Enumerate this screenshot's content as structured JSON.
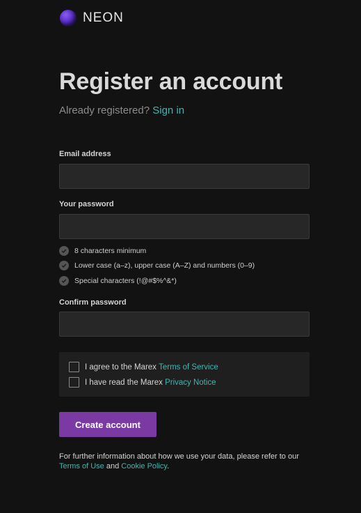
{
  "brand": {
    "name": "NEON"
  },
  "form": {
    "title": "Register an account",
    "already_registered": "Already registered?",
    "sign_in_link": "Sign in",
    "email_label": "Email address",
    "email_value": "",
    "password_label": "Your password",
    "password_value": "",
    "password_rules": [
      "8 characters minimum",
      "Lower case (a–z), upper case (A–Z) and numbers (0–9)",
      "Special characters (!@#$%^&*)"
    ],
    "confirm_label": "Confirm password",
    "confirm_value": ""
  },
  "agreements": {
    "terms_prefix": "I agree to the Marex",
    "terms_link": "Terms of Service",
    "terms_checked": false,
    "privacy_prefix": "I have read the Marex",
    "privacy_link": "Privacy Notice",
    "privacy_checked": false
  },
  "submit": {
    "label": "Create account"
  },
  "footer": {
    "text_before": "For further information about how we use your data, please refer to our",
    "terms_of_use_link": "Terms of Use",
    "and": "and",
    "cookie_policy_link": "Cookie Policy",
    "period": "."
  },
  "colors": {
    "background": "#121212",
    "accent_link": "#3fb6b0",
    "button": "#7b3aa3",
    "input_bg": "#272727"
  }
}
